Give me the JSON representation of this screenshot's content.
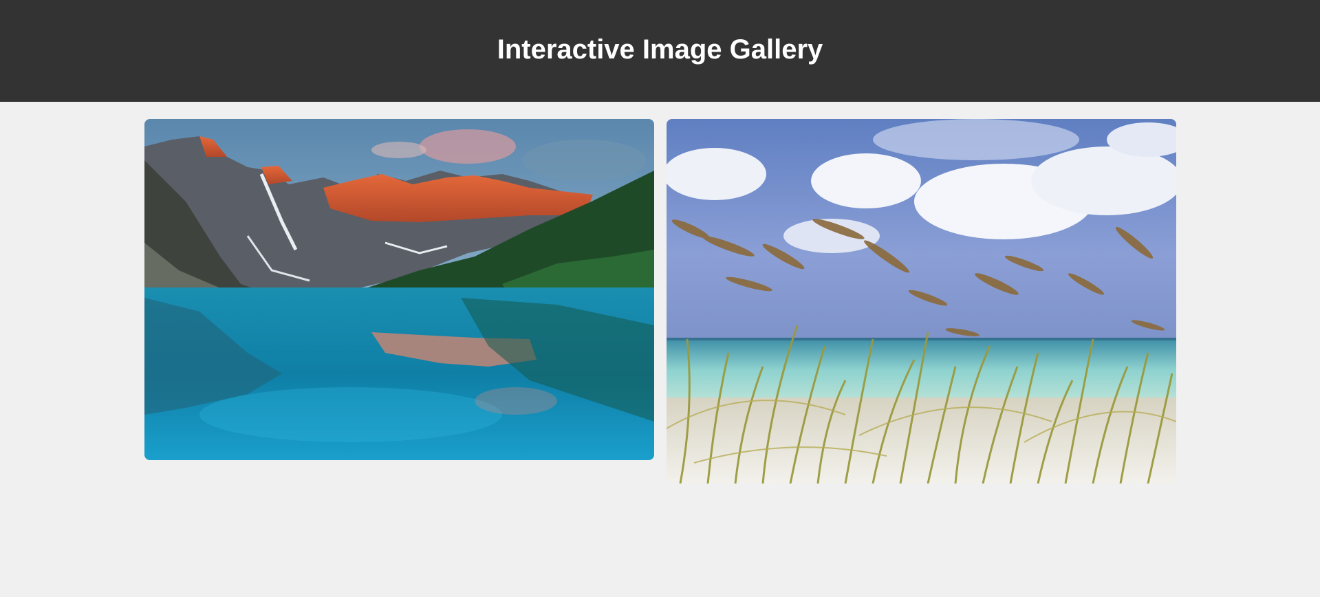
{
  "header": {
    "title": "Interactive Image Gallery",
    "background_color": "#333333"
  },
  "gallery": {
    "background_color": "#f0f0f0",
    "images": [
      {
        "subject": "mountain-lake-landscape"
      },
      {
        "subject": "beach-sea-oats-landscape"
      }
    ]
  }
}
